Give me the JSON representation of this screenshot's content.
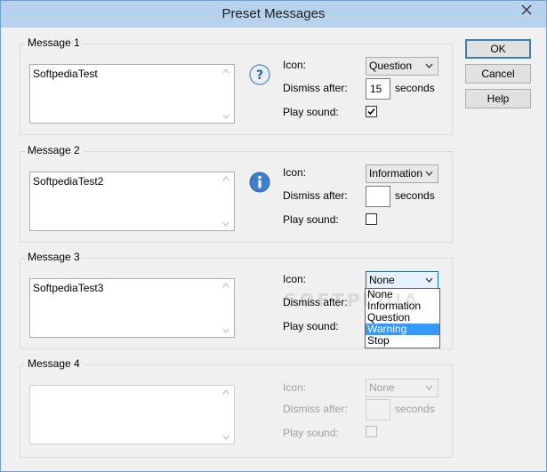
{
  "window": {
    "title": "Preset Messages"
  },
  "common": {
    "icon_label": "Icon:",
    "dismiss_label": "Dismiss after:",
    "seconds_label": "seconds",
    "sound_label": "Play sound:"
  },
  "groups": [
    {
      "label": "Message 1",
      "message": "SoftpediaTest",
      "icon_value": "Question",
      "dismiss_value": "15",
      "play_sound": true,
      "icon": "question-icon"
    },
    {
      "label": "Message 2",
      "message": "SoftpediaTest2",
      "icon_value": "Information",
      "dismiss_value": "",
      "play_sound": false,
      "icon": "information-icon"
    },
    {
      "label": "Message 3",
      "message": "SoftpediaTest3",
      "icon_value": "None",
      "dismiss_value": "",
      "play_sound": false
    },
    {
      "label": "Message 4",
      "message": "",
      "icon_value": "None",
      "dismiss_value": "",
      "play_sound": false,
      "disabled": true
    }
  ],
  "dropdown": {
    "options": [
      "None",
      "Information",
      "Question",
      "Warning",
      "Stop"
    ],
    "highlighted": "Warning"
  },
  "buttons": {
    "ok": "OK",
    "cancel": "Cancel",
    "help": "Help"
  },
  "watermark": "SOFTPEDIA",
  "colors": {
    "accent": "#0078d7",
    "highlight": "#3399ff",
    "titlebar": "#b6d2ec",
    "info_icon": "#3f7fd0"
  }
}
